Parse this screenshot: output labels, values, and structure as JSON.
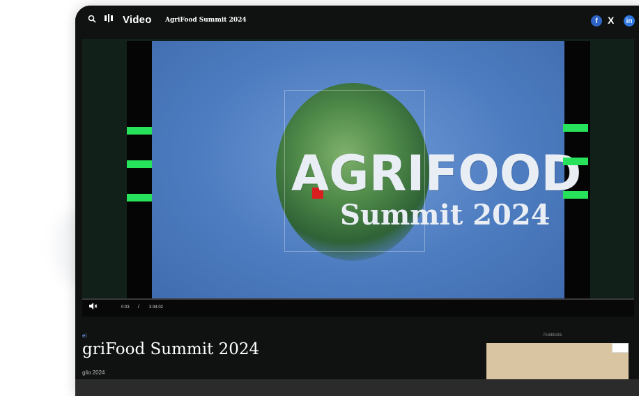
{
  "header": {
    "section": "Video",
    "video_title": "AgriFood Summit 2024",
    "share_x": "X"
  },
  "video": {
    "brand": "AGRIFOOD",
    "subtitle": "Summit 2024",
    "time_current": "0:03",
    "time_separator": "/",
    "time_total": "3:34:02",
    "progress": 0.0002
  },
  "article": {
    "category": "ei",
    "title": "griFood Summit 2024",
    "date": "glio 2024"
  },
  "ad": {
    "label": "Pubblicità"
  },
  "colors": {
    "accent_green": "#27e35b",
    "brand_red": "#d81e1e",
    "share_blue": "#2f64c7"
  }
}
